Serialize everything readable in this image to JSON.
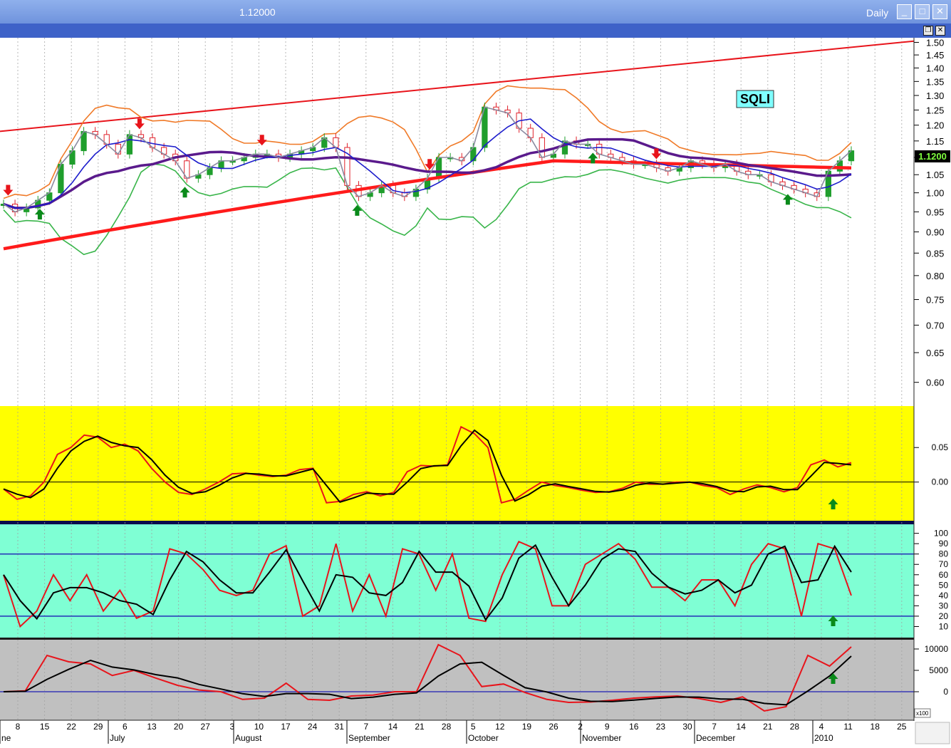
{
  "window": {
    "title_value": "1.12000",
    "period": "Daily",
    "buttons": [
      "minimize-button",
      "maximize-button",
      "close-button"
    ]
  },
  "colors": {
    "main_bg": "#ffffff",
    "macd_bg": "#ffff00",
    "stoch_bg": "#7fffd4",
    "osc_bg": "#c0c0c0",
    "trendline": "#e8141b",
    "ma_long": "#ff1b1b",
    "ma_mid": "#5a1a8c",
    "ma_short": "#1c1ccc",
    "bb_upper": "#f07a28",
    "bb_lower": "#39b54a",
    "up_candle": "#1f9e2c",
    "down_candle": "#e0202a",
    "signal_up": "#0a8a1a",
    "signal_down": "#e8141b"
  },
  "chart_data": [
    {
      "type": "candlestick",
      "name": "price",
      "symbol": "SQLI",
      "last_price_label": "1.1200",
      "y_ticks": [
        0.6,
        0.65,
        0.7,
        0.75,
        0.8,
        0.85,
        0.9,
        0.95,
        1.0,
        1.05,
        1.1,
        1.15,
        1.2,
        1.25,
        1.3,
        1.35,
        1.4,
        1.45,
        1.5
      ],
      "ylim": [
        0.565,
        1.51
      ],
      "y_scale": "log",
      "grid": "vertical dotted",
      "overlays": [
        "trendline",
        "long moving average",
        "medium moving average",
        "short moving average",
        "bollinger upper",
        "bollinger lower",
        "close line"
      ],
      "close": [
        0.97,
        0.95,
        0.96,
        0.98,
        1.0,
        1.08,
        1.12,
        1.18,
        1.17,
        1.14,
        1.11,
        1.17,
        1.16,
        1.13,
        1.11,
        1.09,
        1.04,
        1.05,
        1.07,
        1.09,
        1.09,
        1.1,
        1.11,
        1.11,
        1.1,
        1.11,
        1.12,
        1.13,
        1.16,
        1.13,
        1.02,
        0.99,
        1.0,
        1.02,
        1.0,
        0.99,
        1.01,
        1.04,
        1.1,
        1.1,
        1.09,
        1.13,
        1.26,
        1.25,
        1.24,
        1.19,
        1.16,
        1.1,
        1.11,
        1.15,
        1.14,
        1.14,
        1.11,
        1.1,
        1.09,
        1.08,
        1.08,
        1.07,
        1.06,
        1.07,
        1.09,
        1.08,
        1.07,
        1.08,
        1.06,
        1.05,
        1.05,
        1.03,
        1.02,
        1.01,
        1.0,
        0.99,
        1.06,
        1.09,
        1.12
      ],
      "signals": [
        {
          "type": "buy",
          "date_index": 8
        },
        {
          "type": "buy",
          "date_index": 40
        },
        {
          "type": "buy",
          "date_index": 78
        },
        {
          "type": "buy",
          "date_index": 130
        },
        {
          "type": "buy",
          "date_index": 173
        },
        {
          "type": "sell",
          "date_index": 1
        },
        {
          "type": "sell",
          "date_index": 30
        },
        {
          "type": "sell",
          "date_index": 57
        },
        {
          "type": "sell",
          "date_index": 94
        },
        {
          "type": "sell",
          "date_index": 144
        }
      ]
    },
    {
      "type": "line",
      "name": "macd",
      "y_ticks": [
        0.05,
        0.0
      ],
      "ylim": [
        -0.055,
        0.108
      ],
      "series_colors": [
        "#e8141b",
        "#000000"
      ],
      "values": [
        -0.01,
        -0.025,
        -0.02,
        0.0,
        0.04,
        0.05,
        0.068,
        0.065,
        0.05,
        0.055,
        0.045,
        0.02,
        0.0,
        -0.015,
        -0.018,
        -0.01,
        0.0,
        0.012,
        0.013,
        0.01,
        0.008,
        0.01,
        0.018,
        0.02,
        -0.03,
        -0.028,
        -0.018,
        -0.014,
        -0.02,
        -0.015,
        0.015,
        0.024,
        0.023,
        0.025,
        0.08,
        0.07,
        0.05,
        -0.03,
        -0.025,
        -0.012,
        0.0,
        -0.005,
        -0.008,
        -0.012,
        -0.015,
        -0.014,
        -0.009,
        0.0,
        -0.003,
        -0.003,
        0.0,
        0.0,
        -0.005,
        -0.008,
        -0.018,
        -0.01,
        -0.004,
        -0.008,
        -0.014,
        -0.008,
        0.025,
        0.032,
        0.022,
        0.028
      ],
      "signals": [
        {
          "type": "buy",
          "date_index": 183
        }
      ]
    },
    {
      "type": "line",
      "name": "stochastic",
      "y_ticks": [
        10,
        20,
        30,
        40,
        50,
        60,
        70,
        80,
        90,
        100
      ],
      "ylim": [
        0,
        108
      ],
      "reference_lines": [
        20,
        80
      ],
      "series_colors": [
        "#e8141b",
        "#000000"
      ],
      "values": [
        60,
        10,
        25,
        60,
        35,
        60,
        25,
        45,
        18,
        25,
        85,
        80,
        65,
        45,
        40,
        45,
        80,
        88,
        20,
        30,
        90,
        25,
        60,
        20,
        85,
        80,
        45,
        80,
        18,
        15,
        60,
        92,
        85,
        30,
        30,
        70,
        80,
        90,
        75,
        48,
        48,
        35,
        55,
        55,
        30,
        70,
        90,
        85,
        20,
        90,
        85,
        40
      ],
      "signals": [
        {
          "type": "buy",
          "date_index": 183
        }
      ]
    },
    {
      "type": "line",
      "name": "oscillator",
      "y_ticks": [
        10000,
        5000,
        0
      ],
      "y_scale_note": "x100",
      "ylim": [
        -6500,
        12000
      ],
      "reference_lines": [
        0
      ],
      "series_colors": [
        "#e8141b",
        "#000000"
      ],
      "values": [
        0,
        200,
        8500,
        7000,
        6500,
        3800,
        5000,
        3200,
        1500,
        400,
        0,
        -1800,
        -1500,
        2000,
        -1800,
        -2000,
        -1000,
        -800,
        0,
        0,
        11000,
        8500,
        1200,
        1800,
        -200,
        -1800,
        -2500,
        -2400,
        -2000,
        -1500,
        -1200,
        -1000,
        -1600,
        -2500,
        -1200,
        -4500,
        -3500,
        8500,
        6000,
        10500
      ],
      "signals": [
        {
          "type": "buy",
          "date_index": 183
        }
      ]
    }
  ],
  "x_axis": {
    "day_labels": [
      "8",
      "15",
      "22",
      "29",
      "6",
      "13",
      "20",
      "27",
      "3",
      "10",
      "17",
      "24",
      "31",
      "7",
      "14",
      "21",
      "28",
      "5",
      "12",
      "19",
      "26",
      "2",
      "9",
      "16",
      "23",
      "30",
      "7",
      "14",
      "21",
      "28",
      "4",
      "11",
      "18",
      "25"
    ],
    "month_labels": [
      "ne",
      "July",
      "August",
      "September",
      "October",
      "November",
      "December",
      "2010"
    ]
  }
}
